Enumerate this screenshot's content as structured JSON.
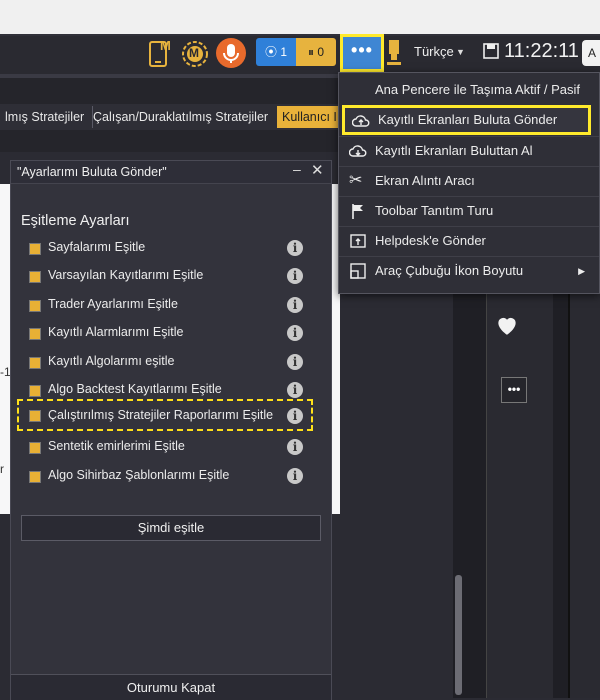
{
  "toolbar": {
    "mobile_icon_letter": "M",
    "coin_icon_letter": "M",
    "record_count": "1",
    "pause_count": "0",
    "more_label": "•••",
    "language": "Türkçe",
    "clock": "11:22:11",
    "search_stub": "A"
  },
  "tabs": [
    {
      "label": "lmış Stratejiler"
    },
    {
      "label": "Çalışan/Duraklatılmış Stratejiler"
    },
    {
      "label": "Kullanıcı I"
    }
  ],
  "menu": {
    "items": [
      {
        "label": "Ana Pencere ile Taşıma Aktif / Pasif",
        "icon": "none"
      },
      {
        "label": "Kayıtlı Ekranları Buluta Gönder",
        "icon": "cloud-upload-icon",
        "highlighted": true
      },
      {
        "label": "Kayıtlı Ekranları Buluttan Al",
        "icon": "cloud-download-icon"
      },
      {
        "label": "Ekran Alıntı Aracı",
        "icon": "scissors-icon"
      },
      {
        "label": "Toolbar Tanıtım Turu",
        "icon": "flag-icon"
      },
      {
        "label": "Helpdesk'e Gönder",
        "icon": "upload-box-icon"
      },
      {
        "label": "Araç Çubuğu İkon Boyutu",
        "icon": "resize-icon",
        "has_submenu": true
      }
    ]
  },
  "dialog": {
    "title": "\"Ayarlarımı Buluta Gönder\"",
    "minimize": "–",
    "close": "✕",
    "section_title": "Eşitleme Ayarları",
    "items": [
      {
        "label": "Sayfalarımı Eşitle"
      },
      {
        "label": "Varsayılan Kayıtlarımı Eşitle"
      },
      {
        "label": "Trader Ayarlarımı Eşitle"
      },
      {
        "label": "Kayıtlı Alarmlarımı Eşitle"
      },
      {
        "label": "Kayıtlı Algolarımı eşitle"
      },
      {
        "label": "Algo Backtest Kayıtlarımı Eşitle"
      },
      {
        "label": "Çalıştırılmış Stratejiler Raporlarımı Eşitle",
        "highlighted": true
      },
      {
        "label": "Sentetik emirlerimi Eşitle"
      },
      {
        "label": "Algo Sihirbaz Şablonlarımı Eşitle"
      }
    ],
    "info_glyph": "i",
    "sync_button": "Şimdi eşitle",
    "close_session": "Oturumu Kapat"
  },
  "colors": {
    "accent_yellow": "#ffea2c",
    "checkbox": "#e8b035",
    "record_blue": "#2f80d9",
    "mic_orange": "#e86a2c"
  }
}
